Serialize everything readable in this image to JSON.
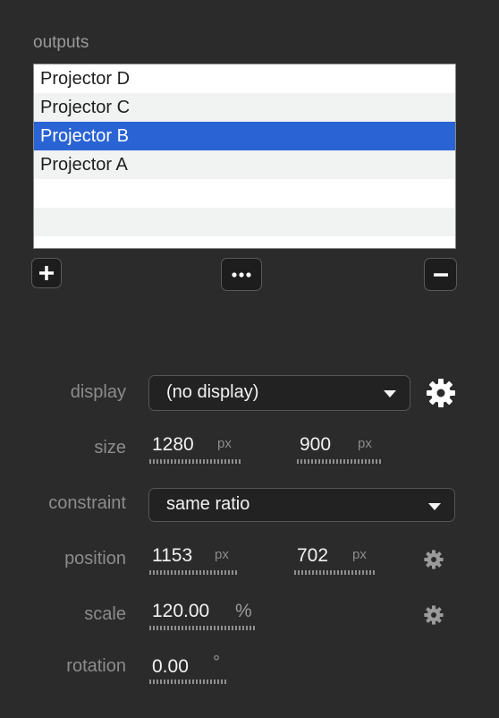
{
  "outputs": {
    "title": "outputs",
    "items": [
      "Projector D",
      "Projector C",
      "Projector B",
      "Projector A"
    ],
    "selected": "Projector B"
  },
  "buttons": {
    "add_icon": "plus-icon",
    "more_icon": "ellipsis-icon",
    "remove_icon": "minus-icon"
  },
  "display": {
    "label": "display",
    "value": "(no display)"
  },
  "size": {
    "label": "size",
    "width": "1280",
    "width_unit": "px",
    "height": "900",
    "height_unit": "px"
  },
  "constraint": {
    "label": "constraint",
    "value": "same ratio"
  },
  "position": {
    "label": "position",
    "x": "1153",
    "x_unit": "px",
    "y": "702",
    "y_unit": "px"
  },
  "scale": {
    "label": "scale",
    "value": "120.00",
    "unit": "%"
  },
  "rotation": {
    "label": "rotation",
    "value": "0.00",
    "unit": "°"
  },
  "colors": {
    "background": "#2b2b2b",
    "selection": "#2a63d4",
    "list_bg": "#ffffff",
    "list_alt": "#f1f3f3"
  }
}
